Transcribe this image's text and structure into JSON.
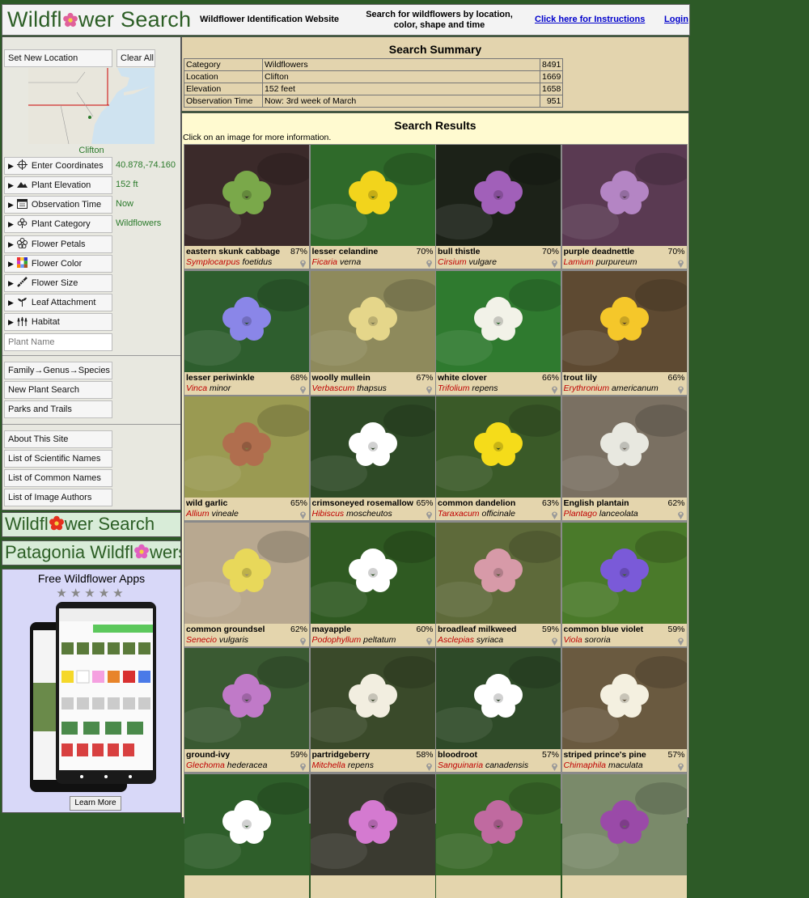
{
  "header": {
    "logo_text_1": "Wildfl",
    "logo_text_2": "wer Search",
    "site_name": "Wildflower Identification Website",
    "tagline": "Search for wildflowers by location, color, shape and time",
    "instructions_link": "Click here for Instructions",
    "login_link": "Login"
  },
  "sidebar": {
    "set_location": "Set New Location",
    "clear_all": "Clear All",
    "map_label": "Clifton",
    "filters": [
      {
        "label": "Enter Coordinates",
        "icon": "crosshair-icon",
        "value": "40.878,-74.160"
      },
      {
        "label": "Plant Elevation",
        "icon": "mountain-icon",
        "value": "152 ft"
      },
      {
        "label": "Observation Time",
        "icon": "calendar-icon",
        "value": "Now"
      },
      {
        "label": "Plant Category",
        "icon": "flower-category-icon",
        "value": "Wildflowers"
      },
      {
        "label": "Flower Petals",
        "icon": "petals-icon",
        "value": ""
      },
      {
        "label": "Flower Color",
        "icon": "color-palette-icon",
        "value": ""
      },
      {
        "label": "Flower Size",
        "icon": "ruler-icon",
        "value": ""
      },
      {
        "label": "Leaf Attachment",
        "icon": "leaf-icon",
        "value": ""
      },
      {
        "label": "Habitat",
        "icon": "habitat-icon",
        "value": ""
      }
    ],
    "plant_name_placeholder": "Plant Name",
    "nav_group_1": [
      "Family→Genus→Species",
      "New Plant Search",
      "Parks and Trails"
    ],
    "nav_group_2": [
      "About This Site",
      "List of Scientific Names",
      "List of Common Names",
      "List of Image Authors"
    ]
  },
  "promos": {
    "wildflower_search_1": "Wildfl",
    "wildflower_search_2": "wer Search",
    "patagonia_1": "Patagonia Wildfl",
    "patagonia_2": "wers"
  },
  "apps": {
    "title": "Free Wildflower Apps",
    "stars": "★★★★★",
    "learn_more": "Learn More"
  },
  "summary": {
    "title": "Search Summary",
    "rows": [
      [
        "Category",
        "Wildflowers",
        "8491"
      ],
      [
        "Location",
        "Clifton",
        "1669"
      ],
      [
        "Elevation",
        "152 feet",
        "1658"
      ],
      [
        "Observation Time",
        "Now: 3rd week of March",
        "951"
      ]
    ]
  },
  "results": {
    "title": "Search Results",
    "hint": "Click on an image for more information.",
    "cards": [
      {
        "name": "eastern skunk cabbage",
        "pct": "87%",
        "genus": "Symplocarpus",
        "species": "foetidus",
        "colors": [
          "#3b2a2a",
          "#7aa84a"
        ]
      },
      {
        "name": "lesser celandine",
        "pct": "70%",
        "genus": "Ficaria",
        "species": "verna",
        "colors": [
          "#2f6a2a",
          "#f2d41c"
        ]
      },
      {
        "name": "bull thistle",
        "pct": "70%",
        "genus": "Cirsium",
        "species": "vulgare",
        "colors": [
          "#1c2218",
          "#a160b9"
        ]
      },
      {
        "name": "purple deadnettle",
        "pct": "70%",
        "genus": "Lamium",
        "species": "purpureum",
        "colors": [
          "#5a3a52",
          "#b485c4"
        ]
      },
      {
        "name": "lesser periwinkle",
        "pct": "68%",
        "genus": "Vinca",
        "species": "minor",
        "colors": [
          "#2e5e2e",
          "#8a86e8"
        ]
      },
      {
        "name": "woolly mullein",
        "pct": "67%",
        "genus": "Verbascum",
        "species": "thapsus",
        "colors": [
          "#8e8a5c",
          "#e5d68a"
        ]
      },
      {
        "name": "white clover",
        "pct": "66%",
        "genus": "Trifolium",
        "species": "repens",
        "colors": [
          "#2f7a2f",
          "#f2f2e8"
        ]
      },
      {
        "name": "trout lily",
        "pct": "66%",
        "genus": "Erythronium",
        "species": "americanum",
        "colors": [
          "#5e4a32",
          "#f5c72a"
        ]
      },
      {
        "name": "wild garlic",
        "pct": "65%",
        "genus": "Allium",
        "species": "vineale",
        "colors": [
          "#9a9a52",
          "#b06e4e"
        ]
      },
      {
        "name": "crimsoneyed rosemallow",
        "pct": "65%",
        "genus": "Hibiscus",
        "species": "moscheutos",
        "colors": [
          "#2e4a26",
          "#ffffff"
        ]
      },
      {
        "name": "common dandelion",
        "pct": "63%",
        "genus": "Taraxacum",
        "species": "officinale",
        "colors": [
          "#3a5a28",
          "#f5dc1a"
        ]
      },
      {
        "name": "English plantain",
        "pct": "62%",
        "genus": "Plantago",
        "species": "lanceolata",
        "colors": [
          "#7a7062",
          "#e8e8e0"
        ]
      },
      {
        "name": "common groundsel",
        "pct": "62%",
        "genus": "Senecio",
        "species": "vulgaris",
        "colors": [
          "#b8a890",
          "#e8d85a"
        ]
      },
      {
        "name": "mayapple",
        "pct": "60%",
        "genus": "Podophyllum",
        "species": "peltatum",
        "colors": [
          "#2f5a22",
          "#ffffff"
        ]
      },
      {
        "name": "broadleaf milkweed",
        "pct": "59%",
        "genus": "Asclepias",
        "species": "syriaca",
        "colors": [
          "#5e6a3a",
          "#d79aa8"
        ]
      },
      {
        "name": "common blue violet",
        "pct": "59%",
        "genus": "Viola",
        "species": "sororia",
        "colors": [
          "#4a7a2a",
          "#7a5ad8"
        ]
      },
      {
        "name": "ground-ivy",
        "pct": "59%",
        "genus": "Glechoma",
        "species": "hederacea",
        "colors": [
          "#3a5a32",
          "#c07ac8"
        ]
      },
      {
        "name": "partridgeberry",
        "pct": "58%",
        "genus": "Mitchella",
        "species": "repens",
        "colors": [
          "#3a4a2a",
          "#f2eee0"
        ]
      },
      {
        "name": "bloodroot",
        "pct": "57%",
        "genus": "Sanguinaria",
        "species": "canadensis",
        "colors": [
          "#2e4a28",
          "#ffffff"
        ]
      },
      {
        "name": "striped prince's pine",
        "pct": "57%",
        "genus": "Chimaphila",
        "species": "maculata",
        "colors": [
          "#6a5a40",
          "#f4f0e0"
        ]
      },
      {
        "name": "",
        "pct": "",
        "genus": "",
        "species": "",
        "colors": [
          "#2e5e2a",
          "#ffffff"
        ]
      },
      {
        "name": "",
        "pct": "",
        "genus": "",
        "species": "",
        "colors": [
          "#3a3a30",
          "#d47ad0"
        ]
      },
      {
        "name": "",
        "pct": "",
        "genus": "",
        "species": "",
        "colors": [
          "#3a6a2a",
          "#c06aa0"
        ]
      },
      {
        "name": "",
        "pct": "",
        "genus": "",
        "species": "",
        "colors": [
          "#7a8a6a",
          "#9a4aa8"
        ]
      }
    ]
  }
}
